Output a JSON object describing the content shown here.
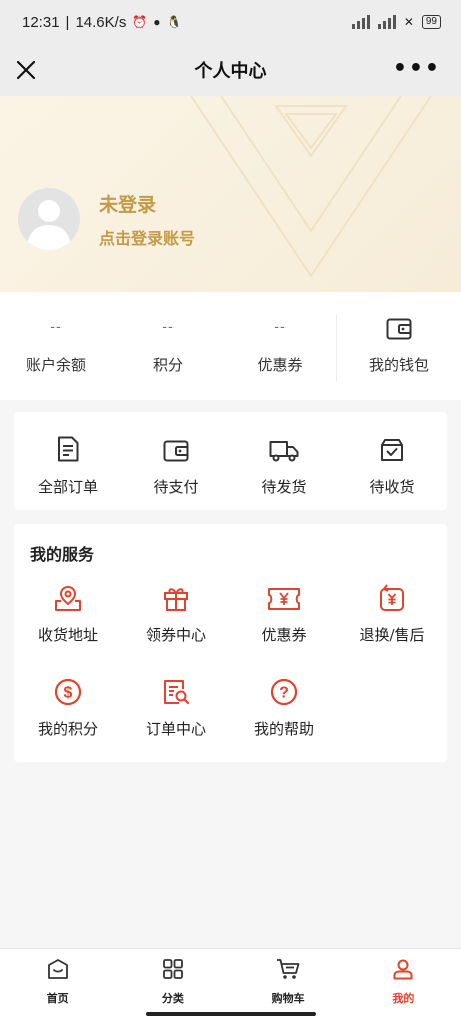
{
  "status_bar": {
    "time": "12:31",
    "speed": "14.6K/s",
    "battery": "99"
  },
  "nav": {
    "title": "个人中心",
    "more": "•••"
  },
  "profile": {
    "login_title": "未登录",
    "login_sub": "点击登录账号"
  },
  "stats": [
    {
      "value": "--",
      "label": "账户余额"
    },
    {
      "value": "--",
      "label": "积分"
    },
    {
      "value": "--",
      "label": "优惠券"
    }
  ],
  "wallet": {
    "label": "我的钱包",
    "icon": "wallet-icon"
  },
  "orders": [
    {
      "label": "全部订单",
      "icon": "order-list-icon"
    },
    {
      "label": "待支付",
      "icon": "wallet-icon"
    },
    {
      "label": "待发货",
      "icon": "truck-icon"
    },
    {
      "label": "待收货",
      "icon": "box-check-icon"
    }
  ],
  "services": {
    "title": "我的服务",
    "items": [
      {
        "label": "收货地址",
        "icon": "location-icon"
      },
      {
        "label": "领券中心",
        "icon": "gift-icon"
      },
      {
        "label": "优惠券",
        "icon": "coupon-icon"
      },
      {
        "label": "退换/售后",
        "icon": "refund-icon"
      },
      {
        "label": "我的积分",
        "icon": "dollar-icon"
      },
      {
        "label": "订单中心",
        "icon": "order-search-icon"
      },
      {
        "label": "我的帮助",
        "icon": "help-icon"
      }
    ]
  },
  "tabs": [
    {
      "label": "首页",
      "icon": "home-icon"
    },
    {
      "label": "分类",
      "icon": "category-icon"
    },
    {
      "label": "购物车",
      "icon": "cart-icon"
    },
    {
      "label": "我的",
      "icon": "user-icon",
      "active": true
    }
  ],
  "colors": {
    "accent": "#e0442c",
    "gold": "#c39a47",
    "header_bg": "#fbf4e6"
  }
}
